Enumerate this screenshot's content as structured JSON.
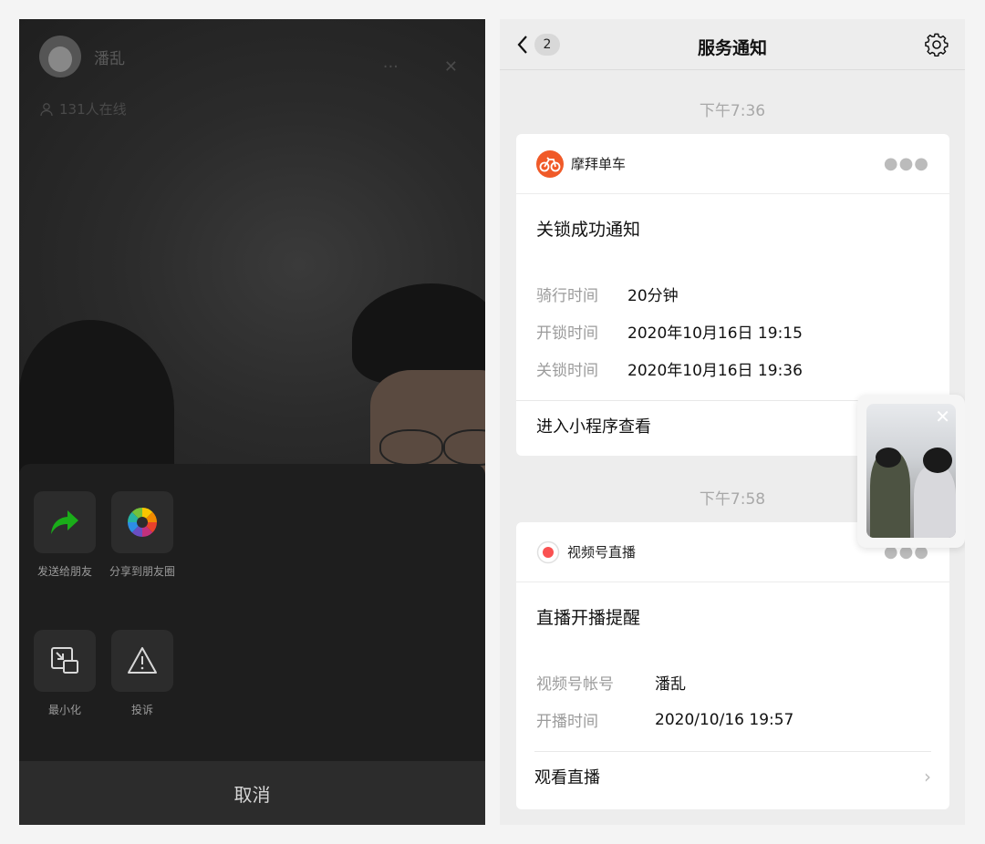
{
  "left": {
    "caller_name": "潘乱",
    "online_text": "131人在线",
    "more_glyph": "···",
    "close_glyph": "✕",
    "actions_row1": [
      {
        "label": "发送给朋友",
        "icon": "share-arrow-icon"
      },
      {
        "label": "分享到朋友圈",
        "icon": "moments-icon"
      }
    ],
    "actions_row2": [
      {
        "label": "最小化",
        "icon": "minimize-icon"
      },
      {
        "label": "投诉",
        "icon": "warning-icon"
      }
    ],
    "cancel_label": "取消",
    "colors": {
      "share_green": "#1aad19",
      "sheet_bg": "#1e1e1e"
    }
  },
  "right": {
    "nav": {
      "unread_count": "2",
      "title": "服务通知"
    },
    "messages": [
      {
        "time": "下午7:36",
        "app_name": "摩拜单车",
        "app_icon": "mobike-icon",
        "title": "关锁成功通知",
        "fields": [
          {
            "k": "骑行时间",
            "v": "20分钟"
          },
          {
            "k": "开锁时间",
            "v": "2020年10月16日 19:15"
          },
          {
            "k": "关锁时间",
            "v": "2020年10月16日 19:36"
          }
        ],
        "footer": "进入小程序查看"
      },
      {
        "time": "下午7:58",
        "app_name": "视频号直播",
        "app_icon": "live-record-icon",
        "title": "直播开播提醒",
        "fields": [
          {
            "k": "视频号帐号",
            "v": "潘乱"
          },
          {
            "k": "开播时间",
            "v": "2020/10/16 19:57"
          }
        ],
        "footer": "观看直播"
      }
    ],
    "colors": {
      "mobike_orange": "#f05a28",
      "live_red": "#fa5151"
    }
  }
}
